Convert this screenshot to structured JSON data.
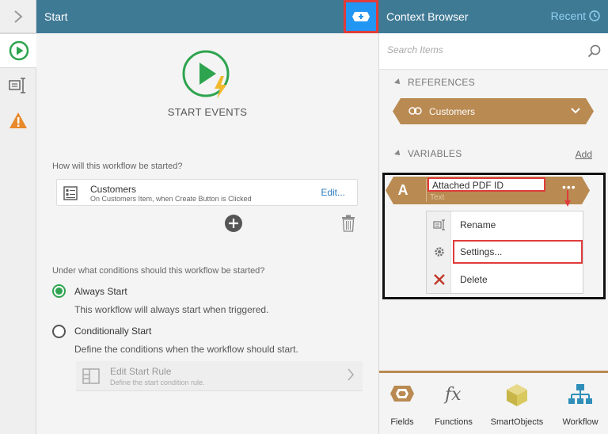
{
  "main": {
    "header_title": "Start",
    "start_title": "START EVENTS",
    "question1": "How will this workflow be started?",
    "event_card": {
      "title": "Customers",
      "subtitle": "On Customers Item, when Create Button is Clicked",
      "edit_label": "Edit..."
    },
    "question2": "Under what conditions should this workflow be started?",
    "options": [
      {
        "label": "Always Start",
        "desc": "This workflow will always start when triggered.",
        "checked": true
      },
      {
        "label": "Conditionally Start",
        "desc": "Define the conditions when the workflow should start.",
        "checked": false
      }
    ],
    "rule": {
      "title": "Edit Start Rule",
      "subtitle": "Define the start condition rule."
    }
  },
  "context_browser": {
    "title": "Context Browser",
    "recent_label": "Recent",
    "search_placeholder": "Search Items",
    "references_label": "REFERENCES",
    "reference_item": "Customers",
    "variables_label": "VARIABLES",
    "add_label": "Add",
    "variable": {
      "letter": "A",
      "name": "Attached PDF ID",
      "type": "Text",
      "dots": "•••"
    },
    "menu": [
      {
        "label": "Rename",
        "icon": "rename-icon"
      },
      {
        "label": "Settings...",
        "icon": "gear-icon"
      },
      {
        "label": "Delete",
        "icon": "delete-x-icon"
      }
    ],
    "toolbar": [
      {
        "label": "Fields",
        "icon": "fields-hex-icon"
      },
      {
        "label": "Functions",
        "icon": "fx-icon"
      },
      {
        "label": "SmartObjects",
        "icon": "cube-icon"
      },
      {
        "label": "Workflow",
        "icon": "workflow-tree-icon"
      }
    ]
  },
  "colors": {
    "header_bg": "#3f7a95",
    "accent_brown": "#b98a52",
    "highlight_red": "#e03c3c",
    "radio_green": "#2ea44f",
    "link_blue": "#2a7bbf"
  }
}
